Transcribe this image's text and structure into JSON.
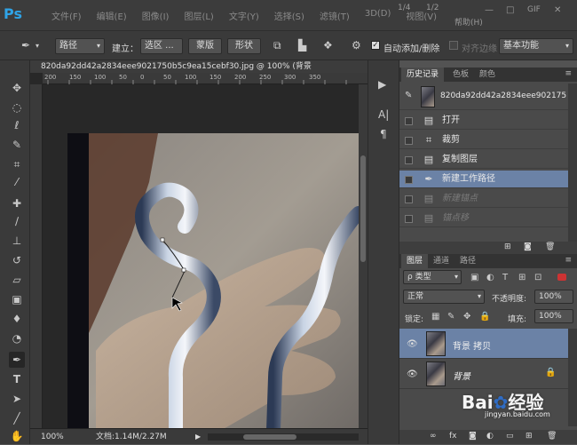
{
  "app": {
    "logo": "Ps",
    "menus": [
      "文件(F)",
      "编辑(E)",
      "图像(I)",
      "图层(L)",
      "文字(Y)",
      "选择(S)",
      "滤镜(T)",
      "3D(D)",
      "视图(V)"
    ],
    "page_indicator_1": "1/4",
    "page_indicator_2": "1/2",
    "menu_tail": "帮助(H)",
    "win_restore": "□",
    "gif_label": "GIF"
  },
  "options": {
    "mode_value": "路径",
    "build_label": "建立：",
    "selection_btn": "选区 ...",
    "mask_btn": "蒙版",
    "shape_btn": "形状",
    "auto_add_label": "自动添加/删除",
    "align_edges_label": "对齐边缘",
    "workspace": "基本功能"
  },
  "document": {
    "tab_title": "820da92dd42a2834eee9021750b5c9ea15cebf30.jpg @ 100% (背景",
    "ruler_h_ticks": [
      "200",
      "150",
      "100",
      "50",
      "0",
      "50",
      "100",
      "150",
      "200",
      "250",
      "300",
      "350"
    ],
    "zoom": "100%",
    "doc_info": "文档:1.14M/2.27M"
  },
  "history": {
    "tabs": [
      "历史记录",
      "色板",
      "颜色"
    ],
    "snapshot_name": "820da92dd42a2834eee902175",
    "items": [
      {
        "icon": "doc-icon",
        "label": "打开",
        "state": "normal"
      },
      {
        "icon": "crop-icon",
        "label": "裁剪",
        "state": "normal"
      },
      {
        "icon": "doc-icon",
        "label": "复制图层",
        "state": "normal"
      },
      {
        "icon": "pen-icon",
        "label": "新建工作路径",
        "state": "selected"
      },
      {
        "icon": "doc-icon",
        "label": "新建锚点",
        "state": "dim"
      },
      {
        "icon": "doc-icon",
        "label": "锚点移",
        "state": "dim"
      }
    ]
  },
  "layers": {
    "tabs": [
      "图层",
      "通道",
      "路径"
    ],
    "filter_type": "ρ 类型",
    "blend_mode": "正常",
    "opacity_label": "不透明度:",
    "opacity_value": "100%",
    "lock_label": "锁定:",
    "fill_label": "填充:",
    "fill_value": "100%",
    "items": [
      {
        "name": "背景 拷贝",
        "selected": true,
        "locked": false
      },
      {
        "name": "背景",
        "selected": false,
        "locked": true
      }
    ]
  },
  "watermark": {
    "brand": "Bai",
    "brand_tail": "经验",
    "sub": "jingyan.baidu.com"
  },
  "colors": {
    "selected_row": "#6b82a6",
    "panel_bg": "#4a4a4a",
    "chrome": "#3a3a3a"
  }
}
